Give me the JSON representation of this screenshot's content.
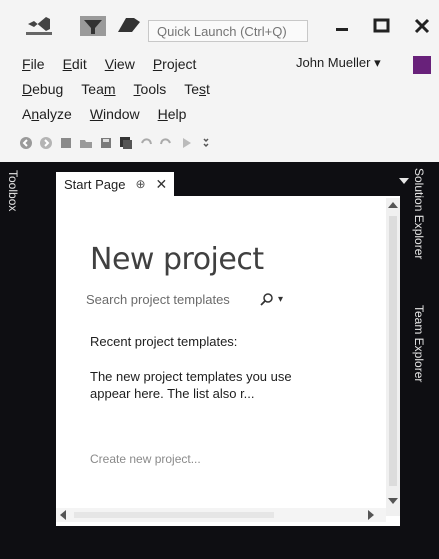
{
  "title_bar": {
    "quick_launch_placeholder": "Quick Launch (Ctrl+Q)",
    "minimize_glyph": "–",
    "maximize_glyph": "□",
    "close_glyph": "✕"
  },
  "menu": {
    "row1": [
      {
        "ul": "F",
        "rest": "ile"
      },
      {
        "ul": "E",
        "rest": "dit"
      },
      {
        "ul": "V",
        "rest": "iew"
      },
      {
        "ul": "P",
        "rest": "roject"
      }
    ],
    "row2": [
      {
        "ul": "D",
        "rest": "ebug"
      },
      {
        "pre": "Tea",
        "ul": "m",
        "rest": ""
      },
      {
        "ul": "T",
        "rest": "ools"
      },
      {
        "pre": "Te",
        "ul": "s",
        "rest": "t"
      }
    ],
    "row3": [
      {
        "pre": "A",
        "ul": "n",
        "rest": "alyze"
      },
      {
        "ul": "W",
        "rest": "indow"
      },
      {
        "ul": "H",
        "rest": "elp"
      }
    ]
  },
  "user": {
    "name": "John Mueller",
    "caret": "▾"
  },
  "side_tabs": {
    "left": "Toolbox",
    "right_top": "Solution Explorer",
    "right_bottom": "Team Explorer"
  },
  "document_tab": {
    "label": "Start Page",
    "pin_glyph": "⊕",
    "close_glyph": "✕"
  },
  "start_page": {
    "heading": "New project",
    "search_placeholder": "Search project templates",
    "search_caret": "▾",
    "recent_label": "Recent project templates:",
    "recent_desc": "The new project templates you use appear here. The list also r...",
    "create_link": "Create new project..."
  },
  "colors": {
    "frame": "#0e0e12",
    "avatar": "#68217a",
    "chrome": "#f4f4f4"
  }
}
